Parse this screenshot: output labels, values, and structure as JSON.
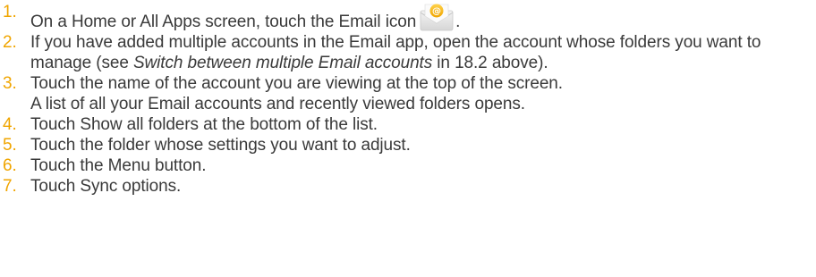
{
  "steps": [
    {
      "num": "1.",
      "text": "On a Home or All Apps screen, touch the Email icon",
      "after_icon": "."
    },
    {
      "num": "2.",
      "text_before": "If you have added multiple accounts in the Email app, open the account whose folders you want to manage (see ",
      "link": "Switch between multiple Email accounts",
      "text_after": " in 18.2 above)."
    },
    {
      "num": "3.",
      "line1": "Touch the name of the account you are viewing at the top of the screen.",
      "line2": "A list of all your Email accounts and recently viewed folders opens."
    },
    {
      "num": "4.",
      "text": "Touch Show all folders at the bottom of the list."
    },
    {
      "num": "5.",
      "text": "Touch the folder whose settings you want to adjust."
    },
    {
      "num": "6.",
      "text": "Touch the Menu button."
    },
    {
      "num": "7.",
      "text": "Touch Sync options."
    }
  ],
  "colors": {
    "number_accent": "#f0a500",
    "body_text": "#3a3a3a"
  },
  "icons": {
    "email_app": "email-app-icon"
  }
}
